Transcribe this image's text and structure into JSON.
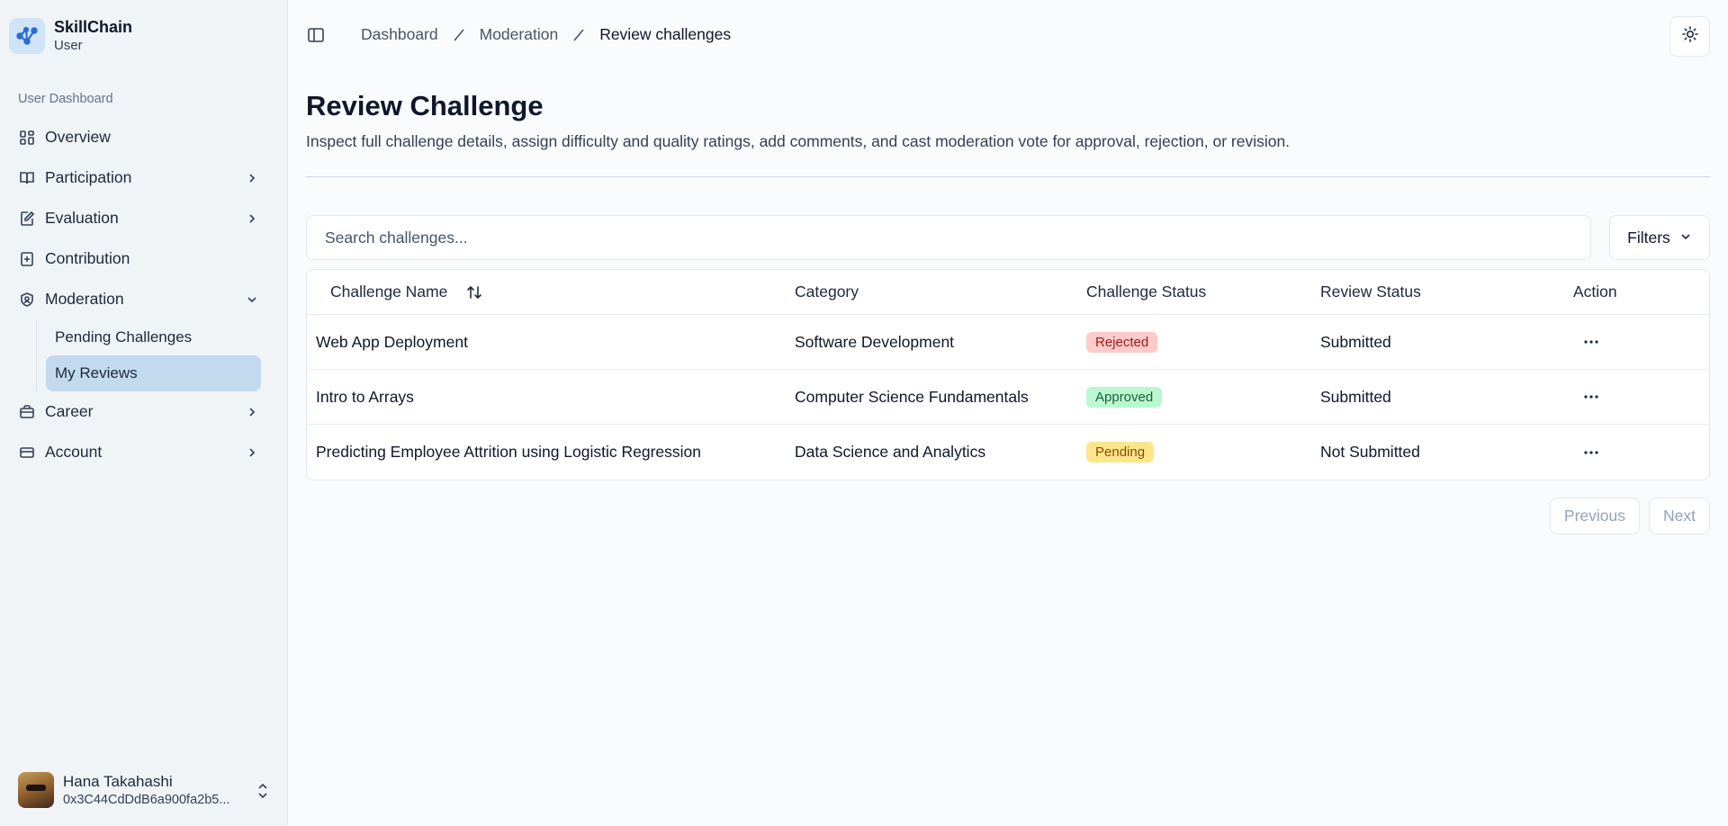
{
  "app": {
    "name": "SkillChain",
    "role": "User"
  },
  "sidebar": {
    "group_label": "User Dashboard",
    "items": [
      {
        "label": "Overview",
        "icon": "grid-icon"
      },
      {
        "label": "Participation",
        "icon": "book-icon"
      },
      {
        "label": "Evaluation",
        "icon": "edit-icon"
      },
      {
        "label": "Contribution",
        "icon": "plus-square-icon"
      },
      {
        "label": "Moderation",
        "icon": "shield-icon"
      },
      {
        "label": "Career",
        "icon": "briefcase-icon"
      },
      {
        "label": "Account",
        "icon": "card-icon"
      }
    ],
    "moderation_sub": [
      "Pending Challenges",
      "My Reviews"
    ],
    "active_sub": "My Reviews"
  },
  "user": {
    "name": "Hana Takahashi",
    "address": "0x3C44CdDdB6a900fa2b5..."
  },
  "breadcrumb": [
    "Dashboard",
    "Moderation",
    "Review challenges"
  ],
  "page": {
    "title": "Review Challenge",
    "description": "Inspect full challenge details, assign difficulty and quality ratings, add comments, and cast moderation vote for approval, rejection, or revision."
  },
  "search": {
    "placeholder": "Search challenges...",
    "value": ""
  },
  "filters_label": "Filters",
  "table": {
    "headers": [
      "Challenge Name",
      "Category",
      "Challenge Status",
      "Review Status",
      "Action"
    ],
    "rows": [
      {
        "name": "Web App Deployment",
        "category": "Software Development",
        "status": "Rejected",
        "review": "Submitted"
      },
      {
        "name": "Intro to Arrays",
        "category": "Computer Science Fundamentals",
        "status": "Approved",
        "review": "Submitted"
      },
      {
        "name": "Predicting Employee Attrition using Logistic Regression",
        "category": "Data Science and Analytics",
        "status": "Pending",
        "review": "Not Submitted"
      }
    ]
  },
  "pagination": {
    "previous": "Previous",
    "next": "Next"
  },
  "colors": {
    "accent": "#2b6cd8",
    "active_bg": "#c3d9ee",
    "rejected": "#fecaca",
    "approved": "#bbf7d0",
    "pending": "#fde68a"
  }
}
